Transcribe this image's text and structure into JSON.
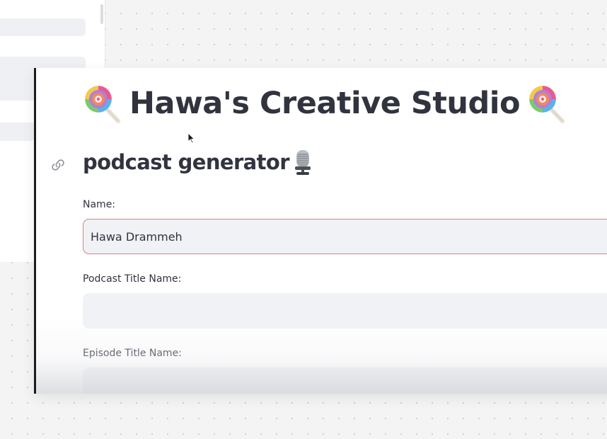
{
  "app": {
    "title": "Hawa's Creative Studio",
    "title_icon_left": "lollipop-icon",
    "title_icon_right": "lollipop-icon"
  },
  "section": {
    "heading": "podcast generator",
    "heading_icon": "studio-microphone-icon",
    "anchor_icon": "link-icon"
  },
  "form": {
    "name": {
      "label": "Name:",
      "value": "Hawa Drammeh",
      "focused": true
    },
    "podcast_title": {
      "label": "Podcast Title Name:",
      "value": ""
    },
    "episode_title": {
      "label": "Episode Title Name:",
      "value": ""
    }
  },
  "colors": {
    "text": "#31333f",
    "input_background": "#f0f2f6",
    "focus_border": "#e47e7e"
  }
}
